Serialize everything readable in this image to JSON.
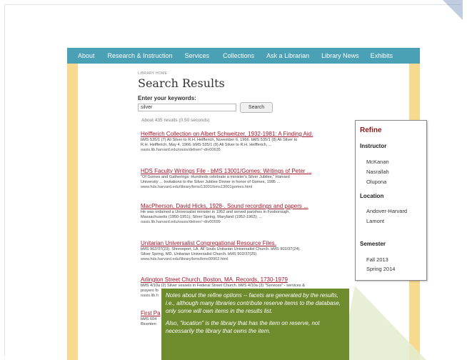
{
  "nav": {
    "items": [
      "About",
      "Research & Instruction",
      "Services",
      "Collections",
      "Ask a Librarian",
      "Library News",
      "Exhibits"
    ]
  },
  "search": {
    "breadcrumb": "LIBRARY HOME",
    "title": "Search Results",
    "keywords_label": "Enter your keywords:",
    "query": "silver",
    "button": "Search",
    "stats": "About 435 results (0.50 seconds)"
  },
  "results": [
    {
      "title": "Helfferich Collection on Albert Schweitzer, 1932-1981: A Finding Aid.",
      "lines": [
        "bMS 535/1 (7) Ali Silver to R.H. Helfferich, November 6, 1966. bMS 535/1 (8) Ali Silver to",
        "R.H. Helfferich, May 4, 1966. bMS 535/1 (9) Ali Silver to R.H. Helfferich, ..."
      ],
      "url": "oasis.lib.harvard.edu/oasis/deliver/~div00635"
    },
    {
      "title": "HDS Faculty Writings File - bMS 13001/Gomes: Writings of Peter ...",
      "lines": [
        "\"Of Gomes and Gatherings: Hundreds celebrate a minister's Silver Jubilee,\" Harvard",
        "University ... Invitations to the Silver Jubilee Dinner in honor of Gomes, 1995 ..."
      ],
      "url": "www.hds.harvard.edu/library/bms/13001/bms13001gomes.html"
    },
    {
      "title": "MacPherson, David Hicks, 1928-. Sound recordings and papers ...",
      "lines": [
        "He was ordained a Universalist minister in 1952 and served parishes in Foxborough,",
        "Massachusetts (1950-1951); Silver Spring, Maryland (1952-1962); ..."
      ],
      "url": "oasis.lib.harvard.edu/oasis/deliver/~div00599"
    },
    {
      "title": "Unitarian Universalist Congregational Resource Files.",
      "lines": [
        "bMS 902/37(23). Shreveport, LA. All Souls Unitarian Universalist Church. bMS 902/37(24).",
        "Silver Spring, MD. Unitarian Universalist Church. bMS 902/37(25)."
      ],
      "url": "www.hds.harvard.edu/library/bms/bms00902.html"
    },
    {
      "title": "Arlington Street Church, Boston, MA. Records, 1730-1979",
      "lines": [
        "bMS 4/10a (2) Silver vessels in Federal Street Church. bMS 4/10a (3) \"Services\" - services &",
        "prayers fo"
      ],
      "url": "oasis.lib.h"
    },
    {
      "title": "First Pa",
      "lines": [
        "bMS 604",
        "Bicenten"
      ],
      "url": ""
    }
  ],
  "refine": {
    "title": "Refine",
    "instructor_label": "Instructor",
    "instructors": [
      "McKanan",
      "Nasrallah",
      "Olupona"
    ],
    "location_label": "Location",
    "locations": [
      "Andover-Harvard",
      "Lamont"
    ],
    "semester_label": "Semester",
    "semesters": [
      "Fall 2013",
      "Spring 2014"
    ]
  },
  "note": {
    "p1": "Notes about the refine options -- facets are generated by the results, i.e., although many libraries contribute reserve items to the database, only some will own items in the results list.",
    "p2": "Also, \"location\" is the library that has the item on reserve, not necessarily the library that owns the item."
  }
}
